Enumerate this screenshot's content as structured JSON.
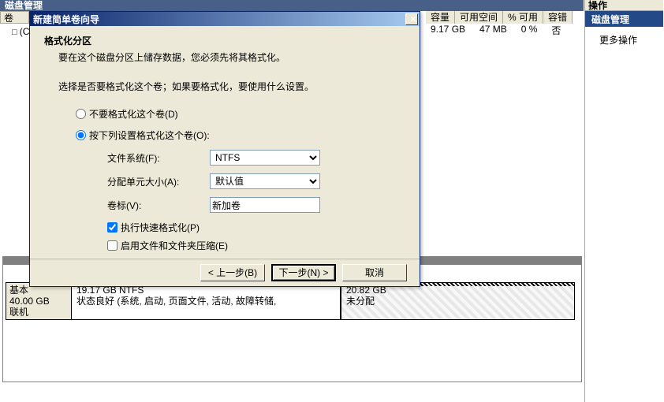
{
  "titleBar": "磁盘管理",
  "colHeaders": {
    "capacity": "容量",
    "free": "可用空间",
    "pctFree": "% 可用",
    "fault": "容错"
  },
  "bgRow": {
    "cap": "9.17 GB",
    "free": "47 MB",
    "pct": "0 %",
    "fault": "否"
  },
  "leftCol": "卷",
  "leftIcon": "(C",
  "side": {
    "title": "操作",
    "header": "磁盘管理",
    "more": "更多操作"
  },
  "dialog": {
    "title": "新建简单卷向导",
    "closeGlyph": "×",
    "heading": "格式化分区",
    "sub": "要在这个磁盘分区上储存数据，您必须先将其格式化。",
    "prompt": "选择是否要格式化这个卷；如果要格式化，要使用什么设置。",
    "radioNo": "不要格式化这个卷(D)",
    "radioYes": "按下列设置格式化这个卷(O):",
    "fsLabel": "文件系统(F):",
    "fsValue": "NTFS",
    "ausLabel": "分配单元大小(A):",
    "ausValue": "默认值",
    "volLabel": "卷标(V):",
    "volValue": "新加卷",
    "quick": "执行快速格式化(P)",
    "compress": "启用文件和文件夹压缩(E)",
    "btnBack": "< 上一步(B)",
    "btnNext": "下一步(N) >",
    "btnCancel": "取消"
  },
  "disk": {
    "hdr1": "基本",
    "hdr2": "40.00 GB",
    "hdr3": "联机",
    "p1a": "19.17 GB NTFS",
    "p1b": "状态良好 (系统, 启动, 页面文件, 活动, 故障转储,",
    "p2a": "20.82 GB",
    "p2b": "未分配"
  }
}
